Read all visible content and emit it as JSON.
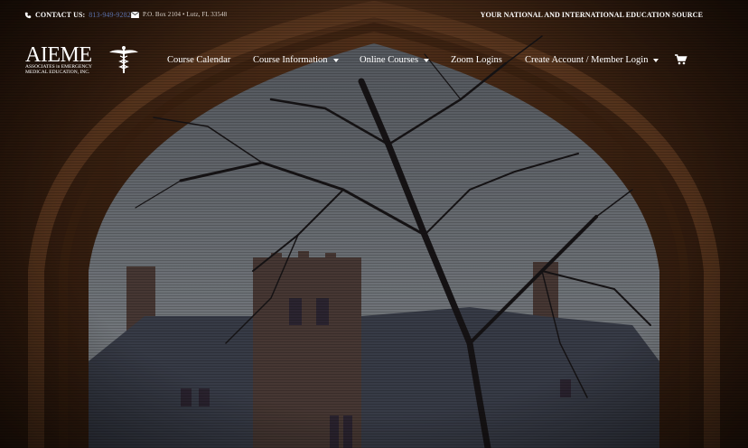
{
  "topbar": {
    "contact_label": "CONTACT US:",
    "phone": "813-949-9282",
    "address": "P.O. Box 2104 • Lutz, FL 33548",
    "tagline": "YOUR NATIONAL AND INTERNATIONAL EDUCATION SOURCE"
  },
  "logo": {
    "name": "AIEME",
    "sub_line1": "ASSOCIATES in EMERGENCY",
    "sub_line2": "MEDICAL EDUCATION, INC."
  },
  "nav": {
    "items": [
      {
        "label": "Course Calendar",
        "dropdown": false
      },
      {
        "label": "Course Information",
        "dropdown": true
      },
      {
        "label": "Online Courses",
        "dropdown": true
      },
      {
        "label": "Zoom Logins",
        "dropdown": false
      },
      {
        "label": "Create Account / Member Login",
        "dropdown": true
      }
    ]
  },
  "icons": {
    "phone": "phone-icon",
    "mail": "mail-icon",
    "cart": "cart-icon"
  },
  "colors": {
    "phone_link": "#5a6fa8",
    "arch_stone": "#6b3f22",
    "sky": "#9aa0a8"
  }
}
